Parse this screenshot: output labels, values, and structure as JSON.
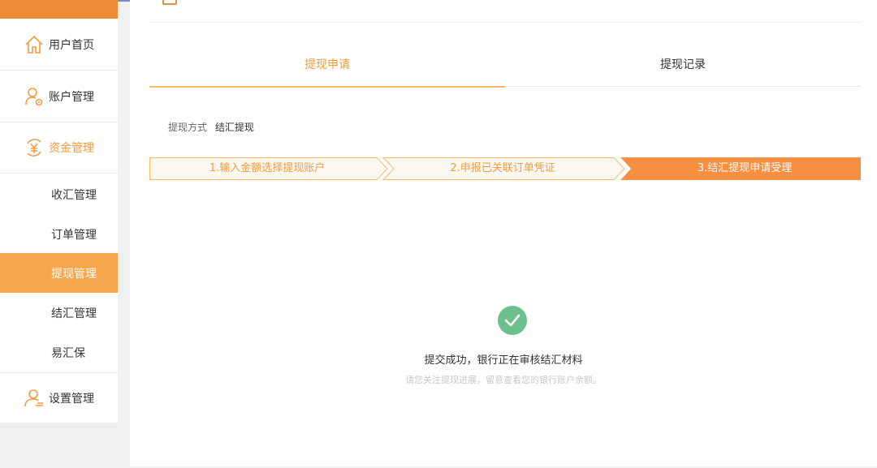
{
  "sidebar": {
    "items": [
      {
        "label": "用户首页",
        "icon": "home-icon"
      },
      {
        "label": "账户管理",
        "icon": "user-gear-icon"
      },
      {
        "label": "资金管理",
        "icon": "yuan-exchange-icon"
      },
      {
        "label": "设置管理",
        "icon": "user-settings-icon"
      }
    ],
    "sub_items": [
      {
        "label": "收汇管理"
      },
      {
        "label": "订单管理"
      },
      {
        "label": "提现管理"
      },
      {
        "label": "结汇管理"
      },
      {
        "label": "易汇保"
      }
    ]
  },
  "tabs": {
    "apply": "提现申请",
    "records": "提现记录"
  },
  "form": {
    "method_label": "提现方式",
    "method_value": "结汇提现"
  },
  "steps": [
    {
      "label": "1.输入金额选择提现账户"
    },
    {
      "label": "2.申报已关联订单凭证"
    },
    {
      "label": "3.结汇提现申请受理"
    }
  ],
  "result": {
    "title": "提交成功，银行正在审核结汇材料",
    "subtitle": "请您关注提现进展，留意查看您的银行账户余额。"
  },
  "colors": {
    "accent": "#f39a3e",
    "active_bg": "#f8a74e",
    "step_active": "#f78f43",
    "success": "#6cc08b"
  }
}
